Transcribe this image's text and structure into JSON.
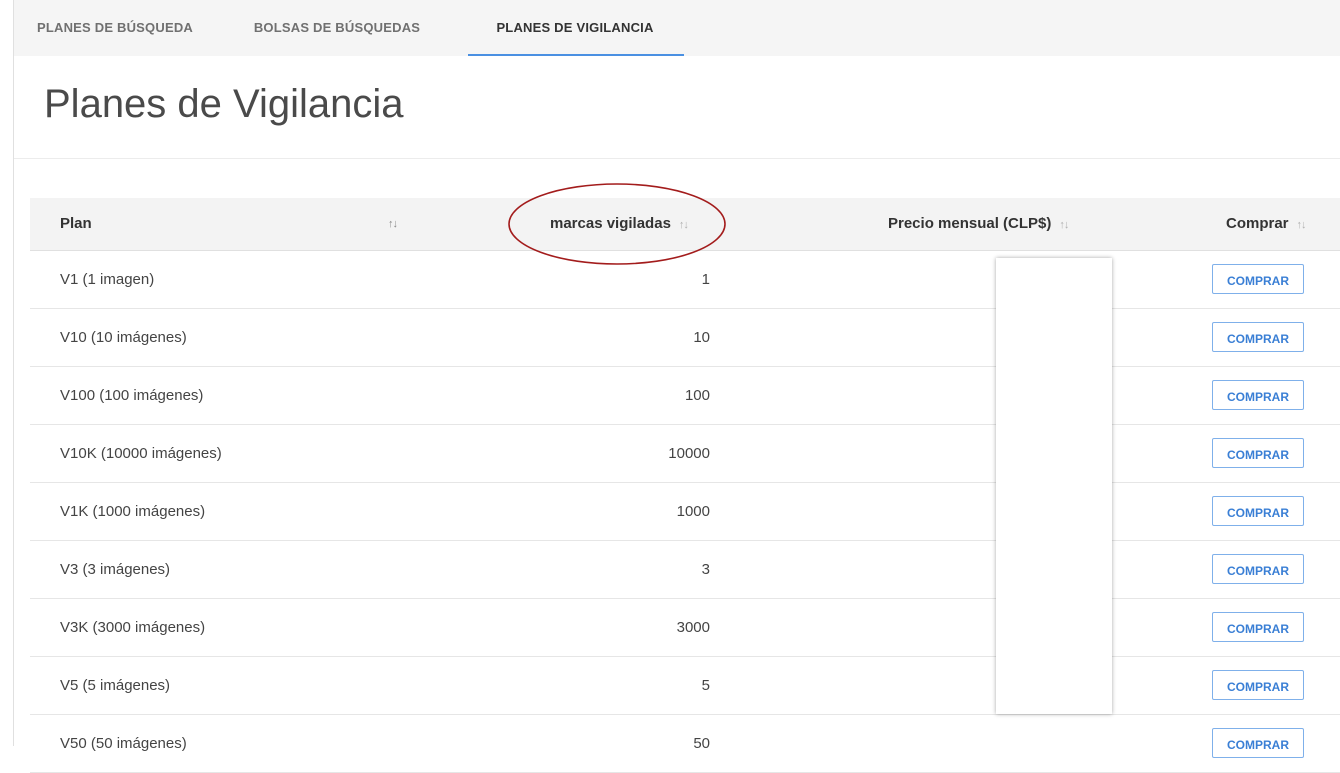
{
  "tabs": [
    {
      "label": "PLANES DE BÚSQUEDA",
      "active": false
    },
    {
      "label": "BOLSAS DE BÚSQUEDAS",
      "active": false
    },
    {
      "label": "PLANES DE VIGILANCIA",
      "active": true
    }
  ],
  "page": {
    "title": "Planes de Vigilancia"
  },
  "table": {
    "headers": {
      "plan": "Plan",
      "count": "marcas vigiladas",
      "price": "Precio mensual (CLP$)",
      "buy": "Comprar",
      "sort_icon": "↑↓"
    },
    "rows": [
      {
        "plan": "V1 (1 imagen)",
        "count": "1",
        "button": "COMPRAR"
      },
      {
        "plan": "V10 (10 imágenes)",
        "count": "10",
        "button": "COMPRAR"
      },
      {
        "plan": "V100 (100 imágenes)",
        "count": "100",
        "button": "COMPRAR"
      },
      {
        "plan": "V10K (10000 imágenes)",
        "count": "10000",
        "button": "COMPRAR"
      },
      {
        "plan": "V1K (1000 imágenes)",
        "count": "1000",
        "button": "COMPRAR"
      },
      {
        "plan": "V3 (3 imágenes)",
        "count": "3",
        "button": "COMPRAR"
      },
      {
        "plan": "V3K (3000 imágenes)",
        "count": "3000",
        "button": "COMPRAR"
      },
      {
        "plan": "V5 (5 imágenes)",
        "count": "5",
        "button": "COMPRAR"
      },
      {
        "plan": "V50 (50 imágenes)",
        "count": "50",
        "button": "COMPRAR"
      }
    ]
  },
  "colors": {
    "accent": "#4a90e2",
    "button_text": "#3a7fd5",
    "annotation": "#a31c1c"
  }
}
